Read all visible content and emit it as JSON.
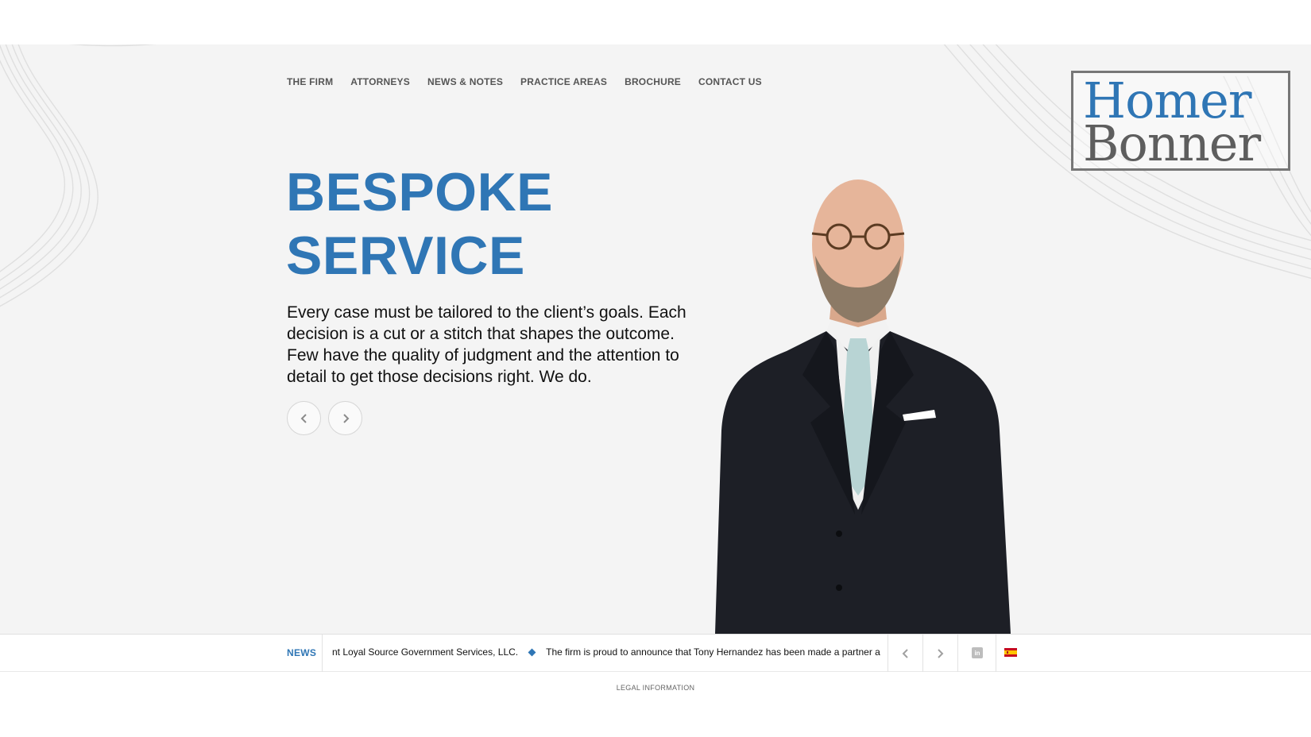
{
  "nav": {
    "items": [
      {
        "label": "THE FIRM"
      },
      {
        "label": "ATTORNEYS"
      },
      {
        "label": "NEWS & NOTES"
      },
      {
        "label": "PRACTICE AREAS"
      },
      {
        "label": "BROCHURE"
      },
      {
        "label": "CONTACT US"
      }
    ]
  },
  "logo": {
    "line1": "Homer",
    "line2": "Bonner"
  },
  "hero": {
    "headline_line1": "BESPOKE",
    "headline_line2": "SERVICE",
    "body": "Every case must be tailored to the client’s goals. Each decision is a cut or a stitch that shapes the outcome. Few have the quality of judgment and the attention to detail to get those decisions right. We do.",
    "prev_icon": "chevron-left-icon",
    "next_icon": "chevron-right-icon"
  },
  "ticker": {
    "label": "NEWS",
    "items": [
      "nt Loyal Source Government Services, LLC.",
      "The firm is proud to announce that Tony Hernandez has been made a partner a"
    ]
  },
  "social": {
    "linkedin_glyph": "in",
    "linkedin_icon": "linkedin-icon",
    "language_icon": "spain-flag-icon"
  },
  "footer": {
    "legal": "LEGAL INFORMATION"
  },
  "colors": {
    "accent": "#2f76b5",
    "text": "#111111",
    "nav": "#555555",
    "logo_gray": "#5e5e5e"
  }
}
